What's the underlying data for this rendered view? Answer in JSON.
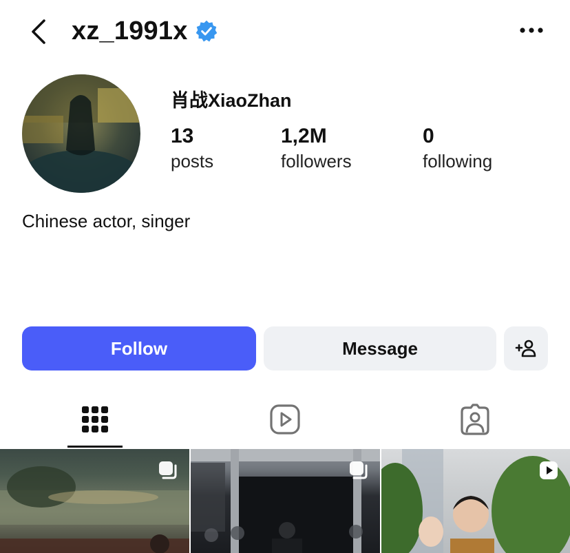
{
  "header": {
    "username": "xz_1991x",
    "verified": true,
    "back_icon": "chevron-left-icon",
    "more_icon": "more-horizontal-icon"
  },
  "profile": {
    "display_name": "肖战XiaoZhan",
    "bio": "Chinese actor, singer",
    "stats": {
      "posts": {
        "value": "13",
        "label": "posts"
      },
      "followers": {
        "value": "1,2M",
        "label": "followers"
      },
      "following": {
        "value": "0",
        "label": "following"
      }
    }
  },
  "actions": {
    "follow_label": "Follow",
    "message_label": "Message",
    "add_user_icon": "add-user-icon"
  },
  "tabs": [
    {
      "name": "grid",
      "icon": "grid-icon",
      "active": true
    },
    {
      "name": "reels",
      "icon": "reels-icon",
      "active": false
    },
    {
      "name": "tagged",
      "icon": "tagged-icon",
      "active": false
    }
  ],
  "grid": [
    {
      "type": "carousel",
      "badge_icon": "carousel-icon"
    },
    {
      "type": "carousel",
      "badge_icon": "carousel-icon"
    },
    {
      "type": "video",
      "badge_icon": "reels-icon"
    }
  ],
  "colors": {
    "accent": "#4a5df9",
    "verified": "#3897f0",
    "secondary_button": "#eff1f4",
    "text": "#111111"
  }
}
